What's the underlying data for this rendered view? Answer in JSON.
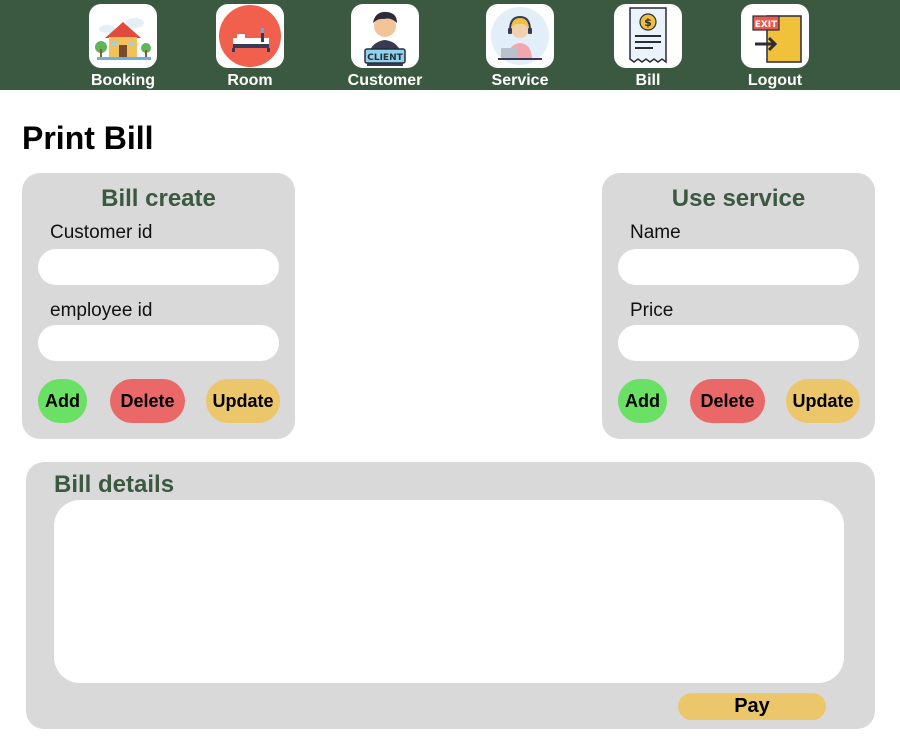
{
  "nav": {
    "items": [
      {
        "label": "Booking",
        "icon": "house-icon"
      },
      {
        "label": "Room",
        "icon": "bed-icon"
      },
      {
        "label": "Customer",
        "icon": "client-icon"
      },
      {
        "label": "Service",
        "icon": "headset-agent-icon"
      },
      {
        "label": "Bill",
        "icon": "receipt-icon"
      },
      {
        "label": "Logout",
        "icon": "exit-door-icon"
      }
    ],
    "background": "#3b5940"
  },
  "page": {
    "title": "Print Bill"
  },
  "bill_create": {
    "title": "Bill create",
    "customer_id_label": "Customer id",
    "customer_id_value": "",
    "employee_id_label": "employee id",
    "employee_id_value": "",
    "add_label": "Add",
    "delete_label": "Delete",
    "update_label": "Update"
  },
  "use_service": {
    "title": "Use service",
    "name_label": "Name",
    "name_value": "",
    "price_label": "Price",
    "price_value": "",
    "add_label": "Add",
    "delete_label": "Delete",
    "update_label": "Update"
  },
  "bill_details": {
    "title": "Bill details",
    "pay_label": "Pay"
  },
  "colors": {
    "accent_green": "#3b5940",
    "panel": "#d9d9d9",
    "add": "#6ae064",
    "delete": "#ea6868",
    "update": "#ecc66a"
  }
}
